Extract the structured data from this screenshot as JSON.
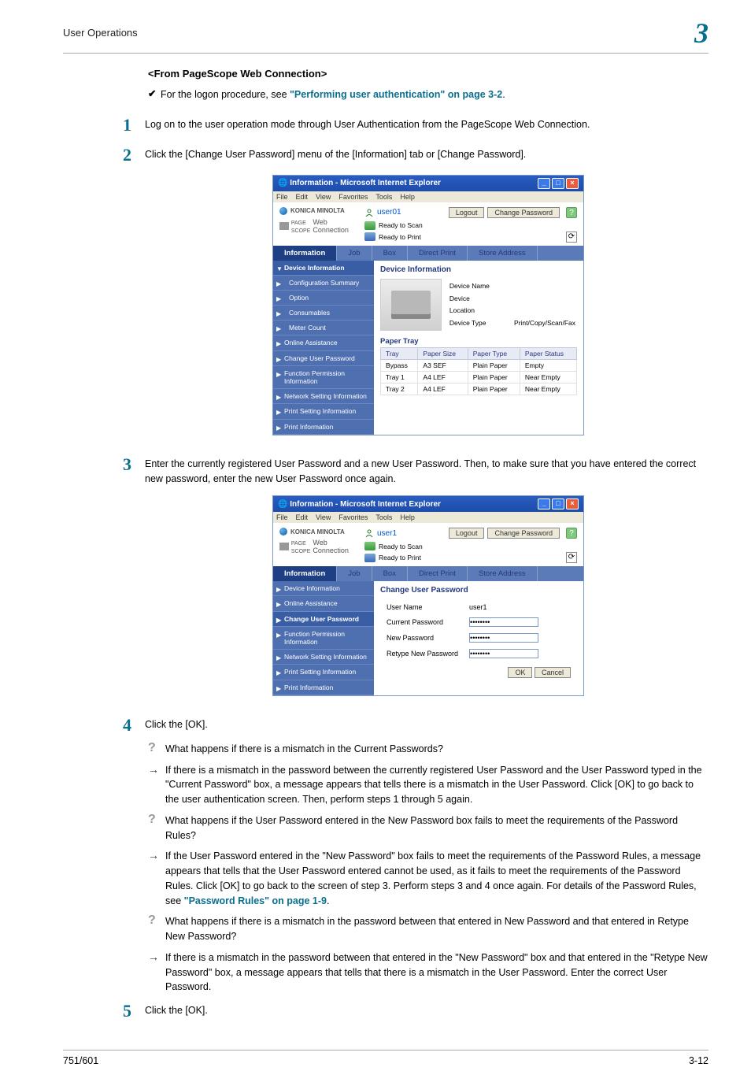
{
  "header": {
    "title": "User Operations",
    "chapter": "3"
  },
  "subhead": "<From PageScope Web Connection>",
  "bullet1": {
    "pre": "For the logon procedure, see ",
    "link": "\"Performing user authentication\" on page 3-2",
    "post": "."
  },
  "steps": {
    "s1": {
      "num": "1",
      "text": "Log on to the user operation mode through User Authentication from the PageScope Web Connection."
    },
    "s2": {
      "num": "2",
      "text": "Click the [Change User Password] menu of the [Information] tab or [Change Password]."
    },
    "s3": {
      "num": "3",
      "text": "Enter the currently registered User Password and a new User Password. Then, to make sure that you have entered the correct new password, enter the new User Password once again."
    },
    "s4": {
      "num": "4",
      "text": "Click the [OK]."
    },
    "s5": {
      "num": "5",
      "text": "Click the [OK]."
    }
  },
  "qa": {
    "q1": "What happens if there is a mismatch in the Current Passwords?",
    "a1": "If there is a mismatch in the password between the currently registered User Password and the User Password typed in the \"Current Password\" box, a message appears that tells there is a mismatch in the User Password. Click [OK] to go back to the user authentication screen. Then, perform steps 1 through 5 again.",
    "q2": "What happens if the User Password entered in the New Password box fails to meet the requirements of the Password Rules?",
    "a2pre": "If the User Password entered in the \"New Password\" box fails to meet the requirements of the Password Rules, a message appears that tells that the User Password entered cannot be used, as it fails to meet the requirements of the Password Rules. Click [OK] to go back to the screen of step 3. Perform steps 3 and 4 once again. For details of the Password Rules, see ",
    "a2link": "\"Password Rules\" on page 1-9",
    "a2post": ".",
    "q3": "What happens if there is a mismatch in the password between that entered in New Password and that entered in Retype New Password?",
    "a3": "If there is a mismatch in the password between that entered in the \"New Password\" box and that entered in the \"Retype New Password\" box, a message appears that tells that there is a mismatch in the User Password. Enter the correct User Password."
  },
  "win": {
    "title": "Information - Microsoft Internet Explorer",
    "menu": [
      "File",
      "Edit",
      "View",
      "Favorites",
      "Tools",
      "Help"
    ],
    "brand": "KONICA MINOLTA",
    "pslabel": "Web Connection",
    "user1": "user01",
    "user2": "user1",
    "logout": "Logout",
    "changepw": "Change Password",
    "ready_scan": "Ready to Scan",
    "ready_print": "Ready to Print",
    "tabs": [
      "Information",
      "Job",
      "Box",
      "Direct Print",
      "Store Address"
    ],
    "side_a": [
      "Device Information",
      "Configuration Summary",
      "Option",
      "Consumables",
      "Meter Count",
      "Online Assistance",
      "Change User Password",
      "Function Permission Information",
      "Network Setting Information",
      "Print Setting Information",
      "Print Information"
    ],
    "side_b": [
      "Device Information",
      "Online Assistance",
      "Change User Password",
      "Function Permission Information",
      "Network Setting Information",
      "Print Setting Information",
      "Print Information"
    ],
    "pane_a_head": "Device Information",
    "pane_b_head": "Change User Password",
    "dev_name": "Device Name",
    "dev_loc": "Device Location",
    "dev_type": "Device Type",
    "dev_type_v": "Print/Copy/Scan/Fax",
    "paper_tray": "Paper Tray",
    "pt_th": [
      "Tray",
      "Paper Size",
      "Paper Type",
      "Paper Status"
    ],
    "pt_rows": [
      [
        "Bypass",
        "A3 SEF",
        "Plain Paper",
        "Empty"
      ],
      [
        "Tray 1",
        "A4 LEF",
        "Plain Paper",
        "Near Empty"
      ],
      [
        "Tray 2",
        "A4 LEF",
        "Plain Paper",
        "Near Empty"
      ]
    ],
    "cp_username_l": "User Name",
    "cp_username_v": "user1",
    "cp_current": "Current Password",
    "cp_new": "New Password",
    "cp_retype": "Retype New Password",
    "ok": "OK",
    "cancel": "Cancel"
  },
  "footer": {
    "left": "751/601",
    "right": "3-12"
  }
}
